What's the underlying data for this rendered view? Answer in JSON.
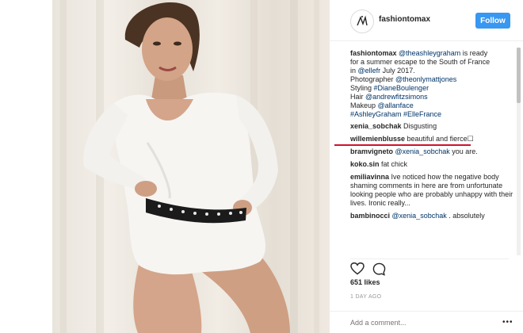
{
  "header": {
    "username": "fashiontomax",
    "follow_label": "Follow"
  },
  "caption": {
    "username": "fashiontomax",
    "mention_graham": "@theashleygraham",
    "text_1": " is ready",
    "line_2": "for a summer escape to the South of France",
    "line_3_pre": "in ",
    "mention_ellefr": "@ellefr",
    "line_3_post": " July 2017.",
    "photographer_label": "Photographer ",
    "mention_photographer": "@theonlymattjones",
    "styling_label": "Styling ",
    "tag_styling": "#DianeBoulenger",
    "hair_label": "Hair ",
    "mention_hair": "@andrewfitzsimons",
    "makeup_label": "Makeup ",
    "mention_makeup": "@allanface",
    "tags": "#AshleyGraham #ElleFrance"
  },
  "comments": [
    {
      "username": "xenia_sobchak",
      "text": " Disgusting"
    },
    {
      "username": "willemienblusse",
      "text": " beautiful and fierce☐"
    },
    {
      "username": "bramvigneto",
      "mention": "@xenia_sobchak",
      "text": " you are."
    },
    {
      "username": "koko.sin",
      "text": " fat chick"
    },
    {
      "username": "emiliavinna",
      "text": " Ive noticed how the negative body shaming comments in here are from unfortunate looking people who are probably unhappy with their lives. Ironic really..."
    },
    {
      "username": "bambinocci",
      "mention": "@xenia_sobchak",
      "text": " . absolutely"
    }
  ],
  "likes": "651 likes",
  "timestamp": "1 DAY AGO",
  "add_comment_placeholder": "Add a comment...",
  "more_glyph": "•••",
  "icons": {
    "like": "heart-icon",
    "comment": "comment-bubble-icon",
    "more": "more-options-icon"
  },
  "colors": {
    "follow": "#3897f0",
    "link": "#003569",
    "highlight": "#d0112b"
  }
}
